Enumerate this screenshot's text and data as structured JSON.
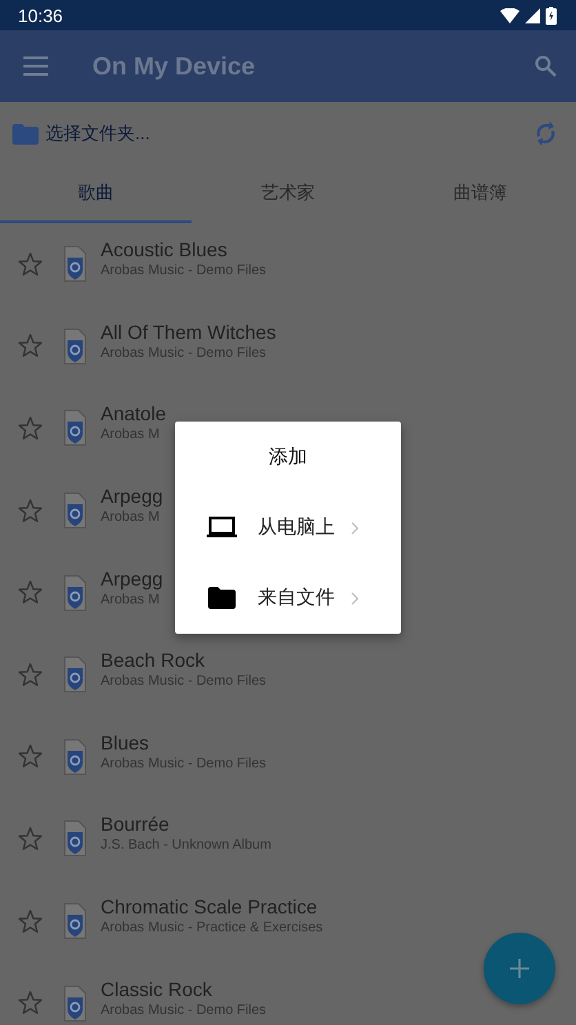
{
  "status_bar": {
    "time": "10:36"
  },
  "app_bar": {
    "title": "On My Device"
  },
  "folder_bar": {
    "label": "选择文件夹..."
  },
  "tabs": [
    {
      "label": "歌曲",
      "selected": true
    },
    {
      "label": "艺术家",
      "selected": false
    },
    {
      "label": "曲谱簿",
      "selected": false
    }
  ],
  "songs": [
    {
      "title": "Acoustic Blues",
      "subtitle": "Arobas Music - Demo Files",
      "starred": false
    },
    {
      "title": "All Of Them Witches",
      "subtitle": "Arobas Music - Demo Files",
      "starred": false
    },
    {
      "title": "Anatole",
      "subtitle": "Arobas M",
      "starred": false
    },
    {
      "title": "Arpegg",
      "subtitle": "Arobas M",
      "starred": false
    },
    {
      "title": "Arpegg",
      "subtitle": "Arobas M",
      "starred": false
    },
    {
      "title": "Beach Rock",
      "subtitle": "Arobas Music - Demo Files",
      "starred": false
    },
    {
      "title": "Blues",
      "subtitle": "Arobas Music - Demo Files",
      "starred": false
    },
    {
      "title": "Bourrée",
      "subtitle": "J.S. Bach - Unknown Album",
      "starred": false
    },
    {
      "title": "Chromatic Scale Practice",
      "subtitle": "Arobas Music - Practice & Exercises",
      "starred": false
    },
    {
      "title": "Classic Rock",
      "subtitle": "Arobas Music - Demo Files",
      "starred": false
    }
  ],
  "dialog": {
    "title": "添加",
    "options": [
      {
        "label": "从电脑上",
        "kind": "computer"
      },
      {
        "label": "来自文件",
        "kind": "file"
      }
    ]
  }
}
